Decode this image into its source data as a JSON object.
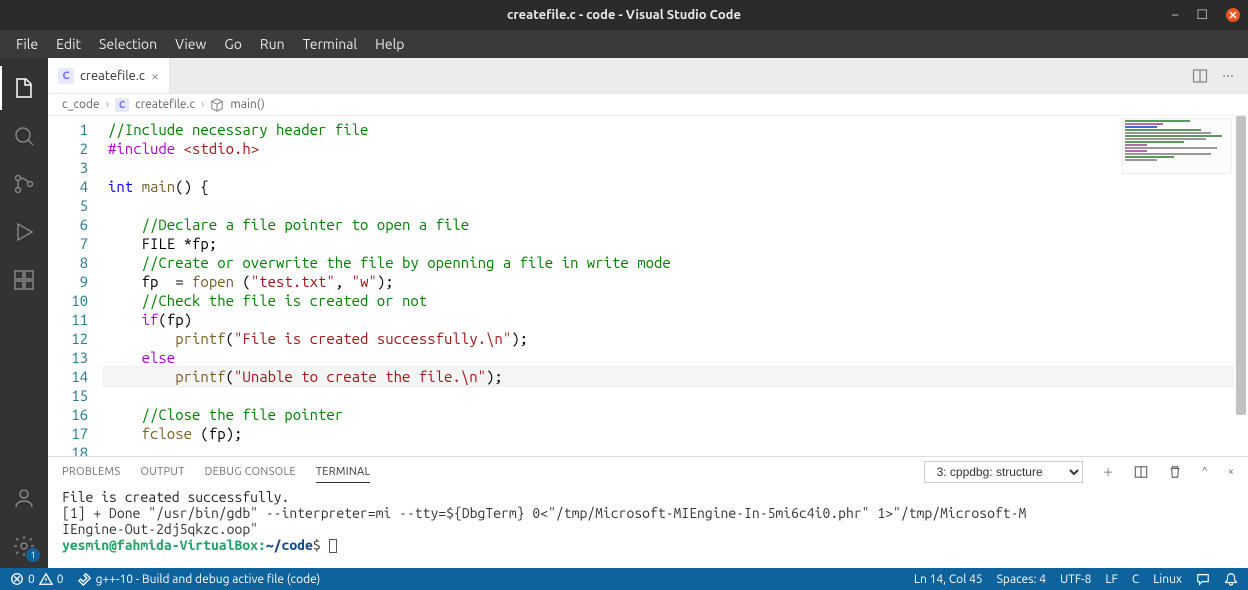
{
  "title": "createfile.c - code - Visual Studio Code",
  "menu": [
    "File",
    "Edit",
    "Selection",
    "View",
    "Go",
    "Run",
    "Terminal",
    "Help"
  ],
  "tab": {
    "icon": "C",
    "name": "createfile.c"
  },
  "breadcrumb": {
    "root": "c_code",
    "file": "createfile.c",
    "symbol": "main()"
  },
  "code": {
    "lines": [
      {
        "n": 1,
        "segs": [
          {
            "c": "cm-comment",
            "t": "//Include necessary header file"
          }
        ]
      },
      {
        "n": 2,
        "segs": [
          {
            "c": "cm-include",
            "t": "#include "
          },
          {
            "c": "cm-header",
            "t": "<stdio.h>"
          }
        ]
      },
      {
        "n": 3,
        "segs": []
      },
      {
        "n": 4,
        "segs": [
          {
            "c": "cm-type",
            "t": "int"
          },
          {
            "c": "",
            "t": " "
          },
          {
            "c": "cm-func",
            "t": "main"
          },
          {
            "c": "",
            "t": "() {"
          }
        ]
      },
      {
        "n": 5,
        "segs": []
      },
      {
        "n": 6,
        "segs": [
          {
            "c": "",
            "t": "    "
          },
          {
            "c": "cm-comment",
            "t": "//Declare a file pointer to open a file"
          }
        ]
      },
      {
        "n": 7,
        "segs": [
          {
            "c": "",
            "t": "    FILE *fp;"
          }
        ]
      },
      {
        "n": 8,
        "segs": [
          {
            "c": "",
            "t": "    "
          },
          {
            "c": "cm-comment",
            "t": "//Create or overwrite the file by openning a file in write mode"
          }
        ]
      },
      {
        "n": 9,
        "segs": [
          {
            "c": "",
            "t": "    fp  = "
          },
          {
            "c": "cm-func",
            "t": "fopen"
          },
          {
            "c": "",
            "t": " ("
          },
          {
            "c": "cm-string",
            "t": "\"test.txt\""
          },
          {
            "c": "",
            "t": ", "
          },
          {
            "c": "cm-string",
            "t": "\"w\""
          },
          {
            "c": "",
            "t": ");"
          }
        ]
      },
      {
        "n": 10,
        "segs": [
          {
            "c": "",
            "t": "    "
          },
          {
            "c": "cm-comment",
            "t": "//Check the file is created or not"
          }
        ]
      },
      {
        "n": 11,
        "segs": [
          {
            "c": "",
            "t": "    "
          },
          {
            "c": "cm-include",
            "t": "if"
          },
          {
            "c": "",
            "t": "(fp)"
          }
        ]
      },
      {
        "n": 12,
        "segs": [
          {
            "c": "",
            "t": "        "
          },
          {
            "c": "cm-func",
            "t": "printf"
          },
          {
            "c": "",
            "t": "("
          },
          {
            "c": "cm-string",
            "t": "\"File is created successfully.\\n\""
          },
          {
            "c": "",
            "t": ");"
          }
        ]
      },
      {
        "n": 13,
        "segs": [
          {
            "c": "",
            "t": "    "
          },
          {
            "c": "cm-include",
            "t": "else"
          }
        ]
      },
      {
        "n": 14,
        "cur": true,
        "segs": [
          {
            "c": "",
            "t": "        "
          },
          {
            "c": "cm-func",
            "t": "printf"
          },
          {
            "c": "",
            "t": "("
          },
          {
            "c": "cm-string",
            "t": "\"Unable to create the file.\\n\""
          },
          {
            "c": "",
            "t": ");"
          }
        ],
        "cursorAfter": 11
      },
      {
        "n": 15,
        "segs": []
      },
      {
        "n": 16,
        "segs": [
          {
            "c": "",
            "t": "    "
          },
          {
            "c": "cm-comment",
            "t": "//Close the file pointer"
          }
        ]
      },
      {
        "n": 17,
        "segs": [
          {
            "c": "",
            "t": "    "
          },
          {
            "c": "cm-func",
            "t": "fclose"
          },
          {
            "c": "",
            "t": " (fp);"
          }
        ]
      },
      {
        "n": 18,
        "segs": []
      }
    ]
  },
  "panel": {
    "tabs": [
      "PROBLEMS",
      "OUTPUT",
      "DEBUG CONSOLE",
      "TERMINAL"
    ],
    "activeTab": 3,
    "selector": "3: cppdbg: structure",
    "lines": [
      "File is created successfully.",
      "[1] + Done                       \"/usr/bin/gdb\" --interpreter=mi --tty=${DbgTerm} 0<\"/tmp/Microsoft-MIEngine-In-5mi6c4i0.phr\" 1>\"/tmp/Microsoft-M",
      "IEngine-Out-2dj5qkzc.oop\""
    ],
    "prompt_user": "yesmin@fahmida-VirtualBox",
    "prompt_path": "~/code",
    "prompt_sym": "$"
  },
  "status": {
    "errors": "0",
    "warnings": "0",
    "build": "g++-10 - Build and debug active file (code)",
    "lncol": "Ln 14, Col 45",
    "spaces": "Spaces: 4",
    "encoding": "UTF-8",
    "eol": "LF",
    "lang": "C",
    "os": "Linux"
  },
  "gear_badge": "1"
}
